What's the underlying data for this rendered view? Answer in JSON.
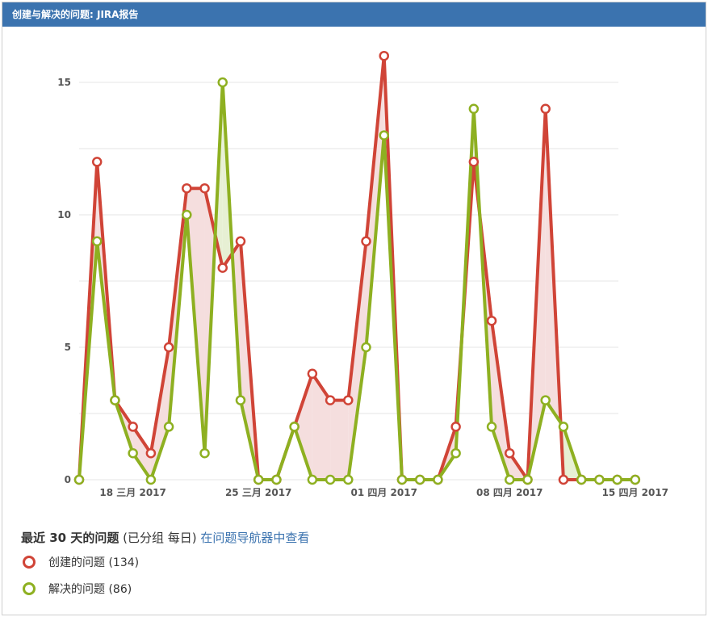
{
  "header": {
    "title": "创建与解决的问题: JIRA报告"
  },
  "chart_data": {
    "type": "line",
    "x": [
      "2017-03-15",
      "2017-03-16",
      "2017-03-17",
      "2017-03-18",
      "2017-03-19",
      "2017-03-20",
      "2017-03-21",
      "2017-03-22",
      "2017-03-23",
      "2017-03-24",
      "2017-03-25",
      "2017-03-26",
      "2017-03-27",
      "2017-03-28",
      "2017-03-29",
      "2017-03-30",
      "2017-03-31",
      "2017-04-01",
      "2017-04-02",
      "2017-04-03",
      "2017-04-04",
      "2017-04-05",
      "2017-04-06",
      "2017-04-07",
      "2017-04-08",
      "2017-04-09",
      "2017-04-10",
      "2017-04-11",
      "2017-04-12",
      "2017-04-13",
      "2017-04-14",
      "2017-04-15"
    ],
    "series": [
      {
        "name": "创建的问题",
        "color": "#d04437",
        "values": [
          0,
          12,
          3,
          2,
          1,
          5,
          11,
          11,
          8,
          9,
          0,
          0,
          2,
          4,
          3,
          3,
          9,
          16,
          0,
          0,
          0,
          2,
          12,
          6,
          1,
          0,
          14,
          0,
          0,
          0,
          0,
          0
        ]
      },
      {
        "name": "解决的问题",
        "color": "#8eb021",
        "values": [
          0,
          9,
          3,
          1,
          0,
          2,
          10,
          1,
          15,
          3,
          0,
          0,
          2,
          0,
          0,
          0,
          5,
          13,
          0,
          0,
          0,
          1,
          14,
          2,
          0,
          0,
          3,
          2,
          0,
          0,
          0,
          0
        ]
      }
    ],
    "fill_created_gt_resolved": "#f5dede",
    "fill_resolved_gt_created": "#e7f0d4",
    "yticks": [
      "0",
      "5",
      "10",
      "15"
    ],
    "ylim": [
      0,
      16
    ],
    "xticks": [
      {
        "label": "18 三月 2017",
        "date": "2017-03-18"
      },
      {
        "label": "25 三月 2017",
        "date": "2017-03-25"
      },
      {
        "label": "01 四月 2017",
        "date": "2017-04-01"
      },
      {
        "label": "08 四月 2017",
        "date": "2017-04-08"
      },
      {
        "label": "15 四月 2017",
        "date": "2017-04-15"
      }
    ],
    "grid": true
  },
  "summary": {
    "title_bold": "最近 30 天的问题",
    "title_rest": " (已分组 每日) ",
    "link_text": "在问题导航器中查看"
  },
  "legend": [
    {
      "label": "创建的问题 (134)",
      "color": "#d04437"
    },
    {
      "label": "解决的问题 (86)",
      "color": "#8eb021"
    }
  ]
}
